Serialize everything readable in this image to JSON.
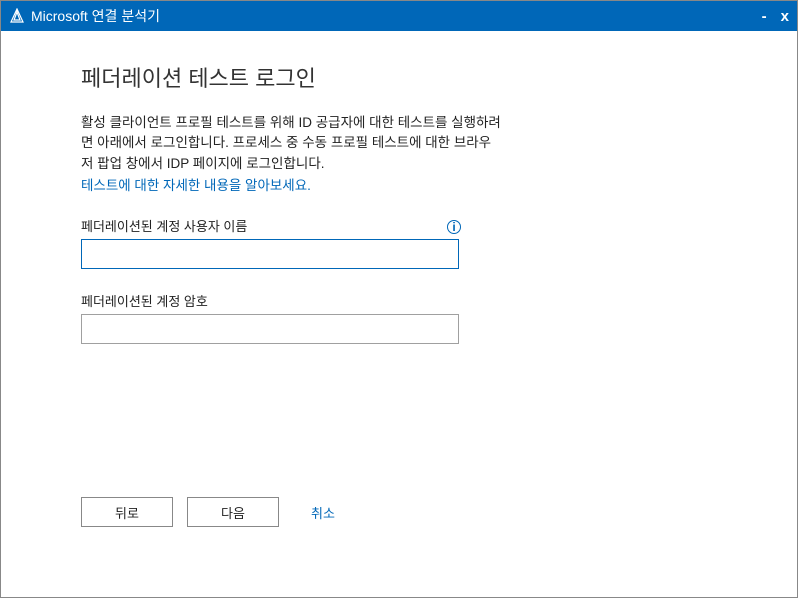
{
  "titlebar": {
    "app_title": "Microsoft 연결 분석기",
    "minimize": "-",
    "close": "x"
  },
  "page": {
    "title": "페더레이션 테스트 로그인",
    "description": "활성 클라이언트 프로필 테스트를 위해 ID 공급자에 대한 테스트를 실행하려면 아래에서 로그인합니다. 프로세스 중 수동 프로필 테스트에 대한 브라우저 팝업 창에서 IDP 페이지에 로그인합니다.",
    "learn_more": "테스트에 대한 자세한 내용을 알아보세요."
  },
  "form": {
    "username_label": "페더레이션된 계정 사용자 이름",
    "username_value": "",
    "password_label": "페더레이션된 계정 암호",
    "password_value": ""
  },
  "buttons": {
    "back": "뒤로",
    "next": "다음",
    "cancel": "취소"
  }
}
